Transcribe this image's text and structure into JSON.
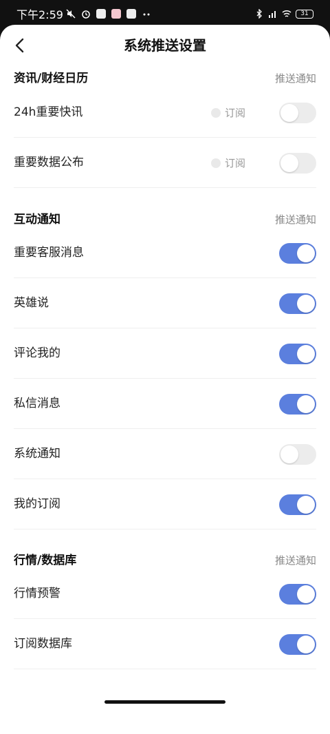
{
  "status_bar": {
    "time": "下午2:59",
    "battery": "31",
    "left_icons": [
      "mute-icon",
      "alarm-icon",
      "app-icon",
      "app-icon",
      "app-icon",
      "more-dots-icon"
    ],
    "right_icons": [
      "bluetooth-icon",
      "signal-icon",
      "wifi-icon",
      "battery-icon"
    ]
  },
  "header": {
    "title": "系统推送设置",
    "back_icon": "chevron-left-icon"
  },
  "colors": {
    "toggle_on": "#5b7fde",
    "toggle_off": "#ececec",
    "secondary_text": "#888888"
  },
  "sections": [
    {
      "title": "资讯/财经日历",
      "right_label": "推送通知",
      "items": [
        {
          "label": "24h重要快讯",
          "subscribe_label": "订阅",
          "enabled": false
        },
        {
          "label": "重要数据公布",
          "subscribe_label": "订阅",
          "enabled": false
        }
      ]
    },
    {
      "title": "互动通知",
      "right_label": "推送通知",
      "items": [
        {
          "label": "重要客服消息",
          "enabled": true
        },
        {
          "label": "英雄说",
          "enabled": true
        },
        {
          "label": "评论我的",
          "enabled": true
        },
        {
          "label": "私信消息",
          "enabled": true
        },
        {
          "label": "系统通知",
          "enabled": false
        },
        {
          "label": "我的订阅",
          "enabled": true
        }
      ]
    },
    {
      "title": "行情/数据库",
      "right_label": "推送通知",
      "items": [
        {
          "label": "行情预警",
          "enabled": true
        },
        {
          "label": "订阅数据库",
          "enabled": true
        }
      ]
    }
  ]
}
